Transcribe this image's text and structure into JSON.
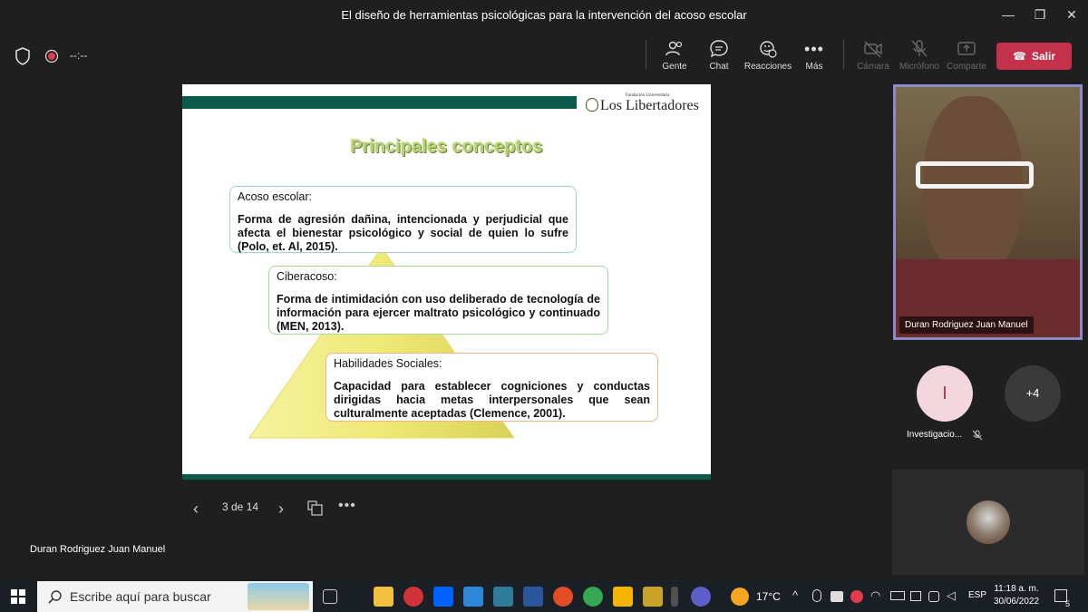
{
  "window": {
    "title": "El diseño de herramientas psicológicas para la intervención del acoso escolar",
    "timer": "--:--"
  },
  "toolbar": {
    "people_label": "Gente",
    "chat_label": "Chat",
    "reactions_label": "Reacciones",
    "more_label": "Más",
    "camera_label": "Cámara",
    "mic_label": "Micrófono",
    "share_label": "Comparte",
    "leave_label": "Salir"
  },
  "slide": {
    "logo_small": "Fundación Universitaria",
    "logo_big": "Los Libertadores",
    "title": "Principales conceptos",
    "cards": [
      {
        "heading": "Acoso escolar:",
        "body": "Forma de agresión dañina, intencionada y perjudicial que afecta el bienestar psicológico y social de quien lo sufre (Polo, et. Al, 2015).",
        "border_color": "#9fd3d8"
      },
      {
        "heading": "Ciberacoso:",
        "body": "Forma de intimidación con uso deliberado de tecnología de información para ejercer maltrato psicológico y continuado (MEN, 2013).",
        "border_color": "#a8d89a"
      },
      {
        "heading": "Habilidades Sociales:",
        "body": "Capacidad para establecer cogniciones y conductas dirigidas hacia metas interpersonales que sean culturalmente aceptadas (Clemence, 2001).",
        "border_color": "#f0b488"
      }
    ]
  },
  "slide_nav": {
    "page": "3 de 14"
  },
  "presenter_name": "Duran Rodriguez Juan Manuel",
  "participants": {
    "video_name": "Duran Rodriguez Juan Manuel",
    "avatar_initial": "I",
    "avatar_name": "Investigacio...",
    "more_count": "+4"
  },
  "taskbar": {
    "search_placeholder": "Escribe aquí para buscar",
    "weather": "17°C",
    "language": "ESP",
    "time": "11:18 a. m.",
    "date": "30/06/2022",
    "notification_count": "5"
  },
  "colors": {
    "leave": "#c4314b",
    "teal": "#0b5a4a",
    "title_green": "#b7d077",
    "avatar_bg": "#f4d7de",
    "avatar_fg": "#a53a55",
    "active_border": "#8b8cc7"
  }
}
